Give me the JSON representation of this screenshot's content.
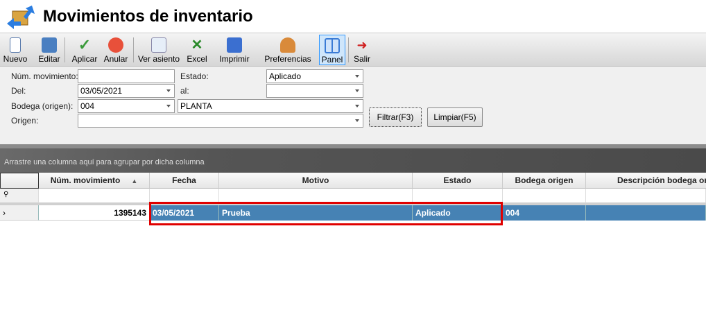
{
  "window": {
    "title": "Movimientos de inventario",
    "icon": "inventory-boxes-icon"
  },
  "toolbar": {
    "items": [
      {
        "label": "Nuevo",
        "icon": "new-document-icon"
      },
      {
        "label": "Editar",
        "icon": "edit-icon"
      },
      {
        "label": "Aplicar",
        "icon": "checkmark-icon"
      },
      {
        "label": "Anular",
        "icon": "cancel-icon"
      },
      {
        "label": "Ver asiento",
        "icon": "view-entry-icon"
      },
      {
        "label": "Excel",
        "icon": "excel-icon"
      },
      {
        "label": "Imprimir",
        "icon": "printer-icon"
      },
      {
        "label": "Preferencias",
        "icon": "user-preferences-icon"
      },
      {
        "label": "Panel",
        "icon": "panel-icon"
      },
      {
        "label": "Salir",
        "icon": "exit-icon"
      }
    ]
  },
  "filters": {
    "num_label": "Núm. movimiento:",
    "num_value": "",
    "estado_label": "Estado:",
    "estado_value": "Aplicado",
    "del_label": "Del:",
    "del_value": "03/05/2021",
    "al_label": "al:",
    "al_value": "",
    "bodega_label": "Bodega (origen):",
    "bodega_code": "004",
    "bodega_name": "PLANTA",
    "origen_label": "Origen:",
    "origen_value": "",
    "filter_button": "Filtrar(F3)",
    "clear_button": "Limpiar(F5)"
  },
  "grid": {
    "group_hint": "Arrastre una columna aquí para agrupar por dicha columna",
    "columns": [
      "Núm. movimiento",
      "Fecha",
      "Motivo",
      "Estado",
      "Bodega origen",
      "Descripción bodega ori"
    ],
    "sort_column": "Núm. movimiento",
    "sort_direction": "ascending",
    "rows": [
      [
        "1395143",
        "03/05/2021",
        "Prueba",
        "Aplicado",
        "004",
        ""
      ]
    ],
    "selection_color": "#4682b4",
    "highlight_color": "#e00000"
  }
}
